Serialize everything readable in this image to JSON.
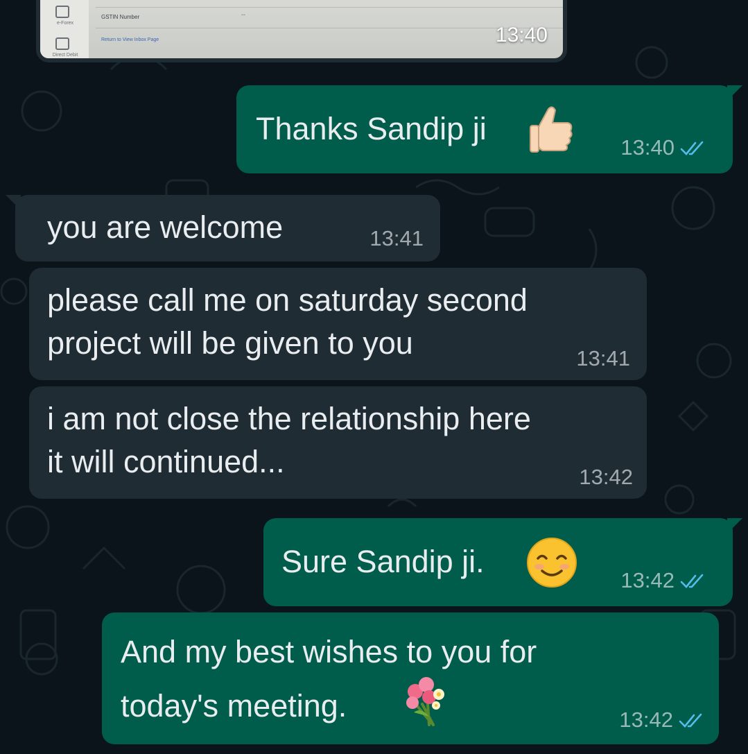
{
  "image_message": {
    "time": "13:40",
    "preview": {
      "side_items": [
        "e-Forex",
        "Direct Debit"
      ],
      "field_label": "GSTIN Number",
      "dash": "--",
      "link": "Return to View Inbox Page"
    }
  },
  "messages": [
    {
      "direction": "outgoing",
      "text": "Thanks Sandip ji",
      "emoji": "thumbs-up-icon",
      "time": "13:40",
      "read": true
    },
    {
      "direction": "incoming",
      "text": "you are welcome",
      "time": "13:41"
    },
    {
      "direction": "incoming",
      "text": "please call me on saturday second\nproject will be given to you",
      "time": "13:41"
    },
    {
      "direction": "incoming",
      "text": "i am not close the relationship here\nit will continued...",
      "time": "13:42"
    },
    {
      "direction": "outgoing",
      "text": "Sure Sandip ji.",
      "emoji": "smiling-face-icon",
      "time": "13:42",
      "read": true
    },
    {
      "direction": "outgoing",
      "text": "And my best wishes to you for\ntoday's meeting.",
      "emoji": "bouquet-icon",
      "time": "13:42",
      "read": true
    }
  ],
  "colors": {
    "background": "#0b141a",
    "outgoing_bubble": "#005c4b",
    "incoming_bubble": "#1f2c34",
    "read_ticks": "#53bdeb"
  }
}
